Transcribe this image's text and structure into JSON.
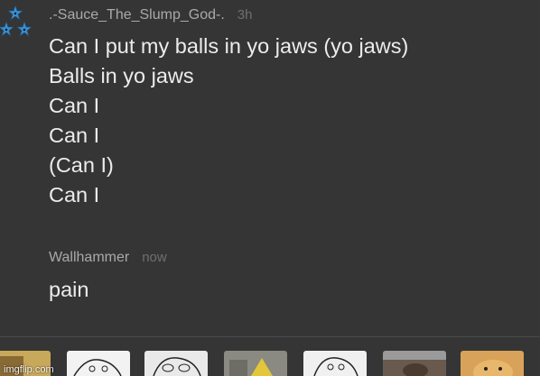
{
  "comments": [
    {
      "author": ".-Sauce_The_Slump_God-.",
      "time": "3h",
      "lines": [
        "Can I put my balls in yo jaws (yo jaws)",
        "Balls in yo jaws",
        "Can I",
        "Can I",
        "(Can I)",
        "Can I"
      ]
    },
    {
      "author": "Wallhammer",
      "time": "now",
      "lines": [
        "pain"
      ]
    }
  ],
  "meme_bar": {
    "items": [
      {
        "name": "meme-thumb-1",
        "color": "#c8a85a"
      },
      {
        "name": "meme-thumb-2",
        "color": "#f2f2f2"
      },
      {
        "name": "meme-thumb-3",
        "color": "#e9e9e9"
      },
      {
        "name": "meme-thumb-4",
        "color": "#8a8a82"
      },
      {
        "name": "meme-thumb-5",
        "color": "#f0f0f0"
      },
      {
        "name": "meme-thumb-6",
        "color": "#6a5a4e"
      },
      {
        "name": "meme-thumb-7",
        "color": "#d9a25a"
      }
    ]
  },
  "watermark": "imgflip.com",
  "colors": {
    "background": "#353535",
    "text": "#ececec",
    "author": "#a9a9a9",
    "timestamp": "#6f6f6f",
    "avatar_blue": "#3a8fd0"
  }
}
